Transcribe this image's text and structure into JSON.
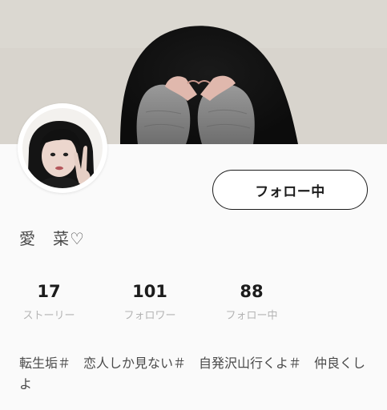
{
  "profile": {
    "name": "愛　菜♡",
    "follow_button_label": "フォロー中",
    "bio": "転生垢＃　恋人しか見ない＃　自発沢山行くよ＃　仲良くしよ"
  },
  "stats": {
    "stories": {
      "value": "17",
      "label": "ストーリー"
    },
    "followers": {
      "value": "101",
      "label": "フォロワー"
    },
    "following": {
      "value": "88",
      "label": "フォロー中"
    }
  },
  "colors": {
    "background": "#fafafa",
    "text_primary": "#1c1c1c",
    "text_secondary": "#4a4a4a",
    "text_muted": "#b4b4b4",
    "button_border": "#1c1c1c"
  },
  "images": {
    "cover": "cover-photo-hands-heart",
    "avatar": "avatar-photo-peace-sign"
  }
}
